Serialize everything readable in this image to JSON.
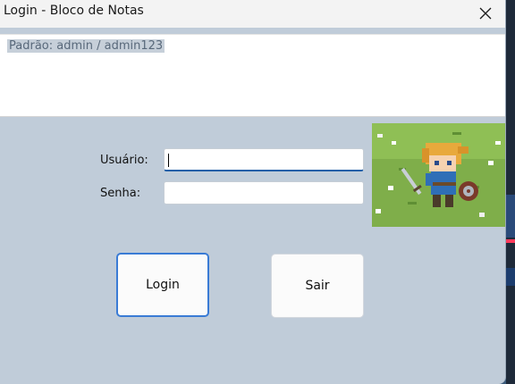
{
  "window": {
    "title": "Login - Bloco de Notas",
    "close_icon": "close-icon"
  },
  "notes": {
    "text": "Padrão: admin / admin123"
  },
  "form": {
    "username_label": "Usuário:",
    "username_value": "",
    "password_label": "Senha:",
    "password_value": ""
  },
  "buttons": {
    "login_label": "Login",
    "exit_label": "Sair"
  },
  "image": {
    "icon": "pixel-hero-image"
  },
  "colors": {
    "window_bg": "#c0ccd9",
    "accent": "#3a7bd5",
    "focus_underline": "#1f5fa8"
  }
}
